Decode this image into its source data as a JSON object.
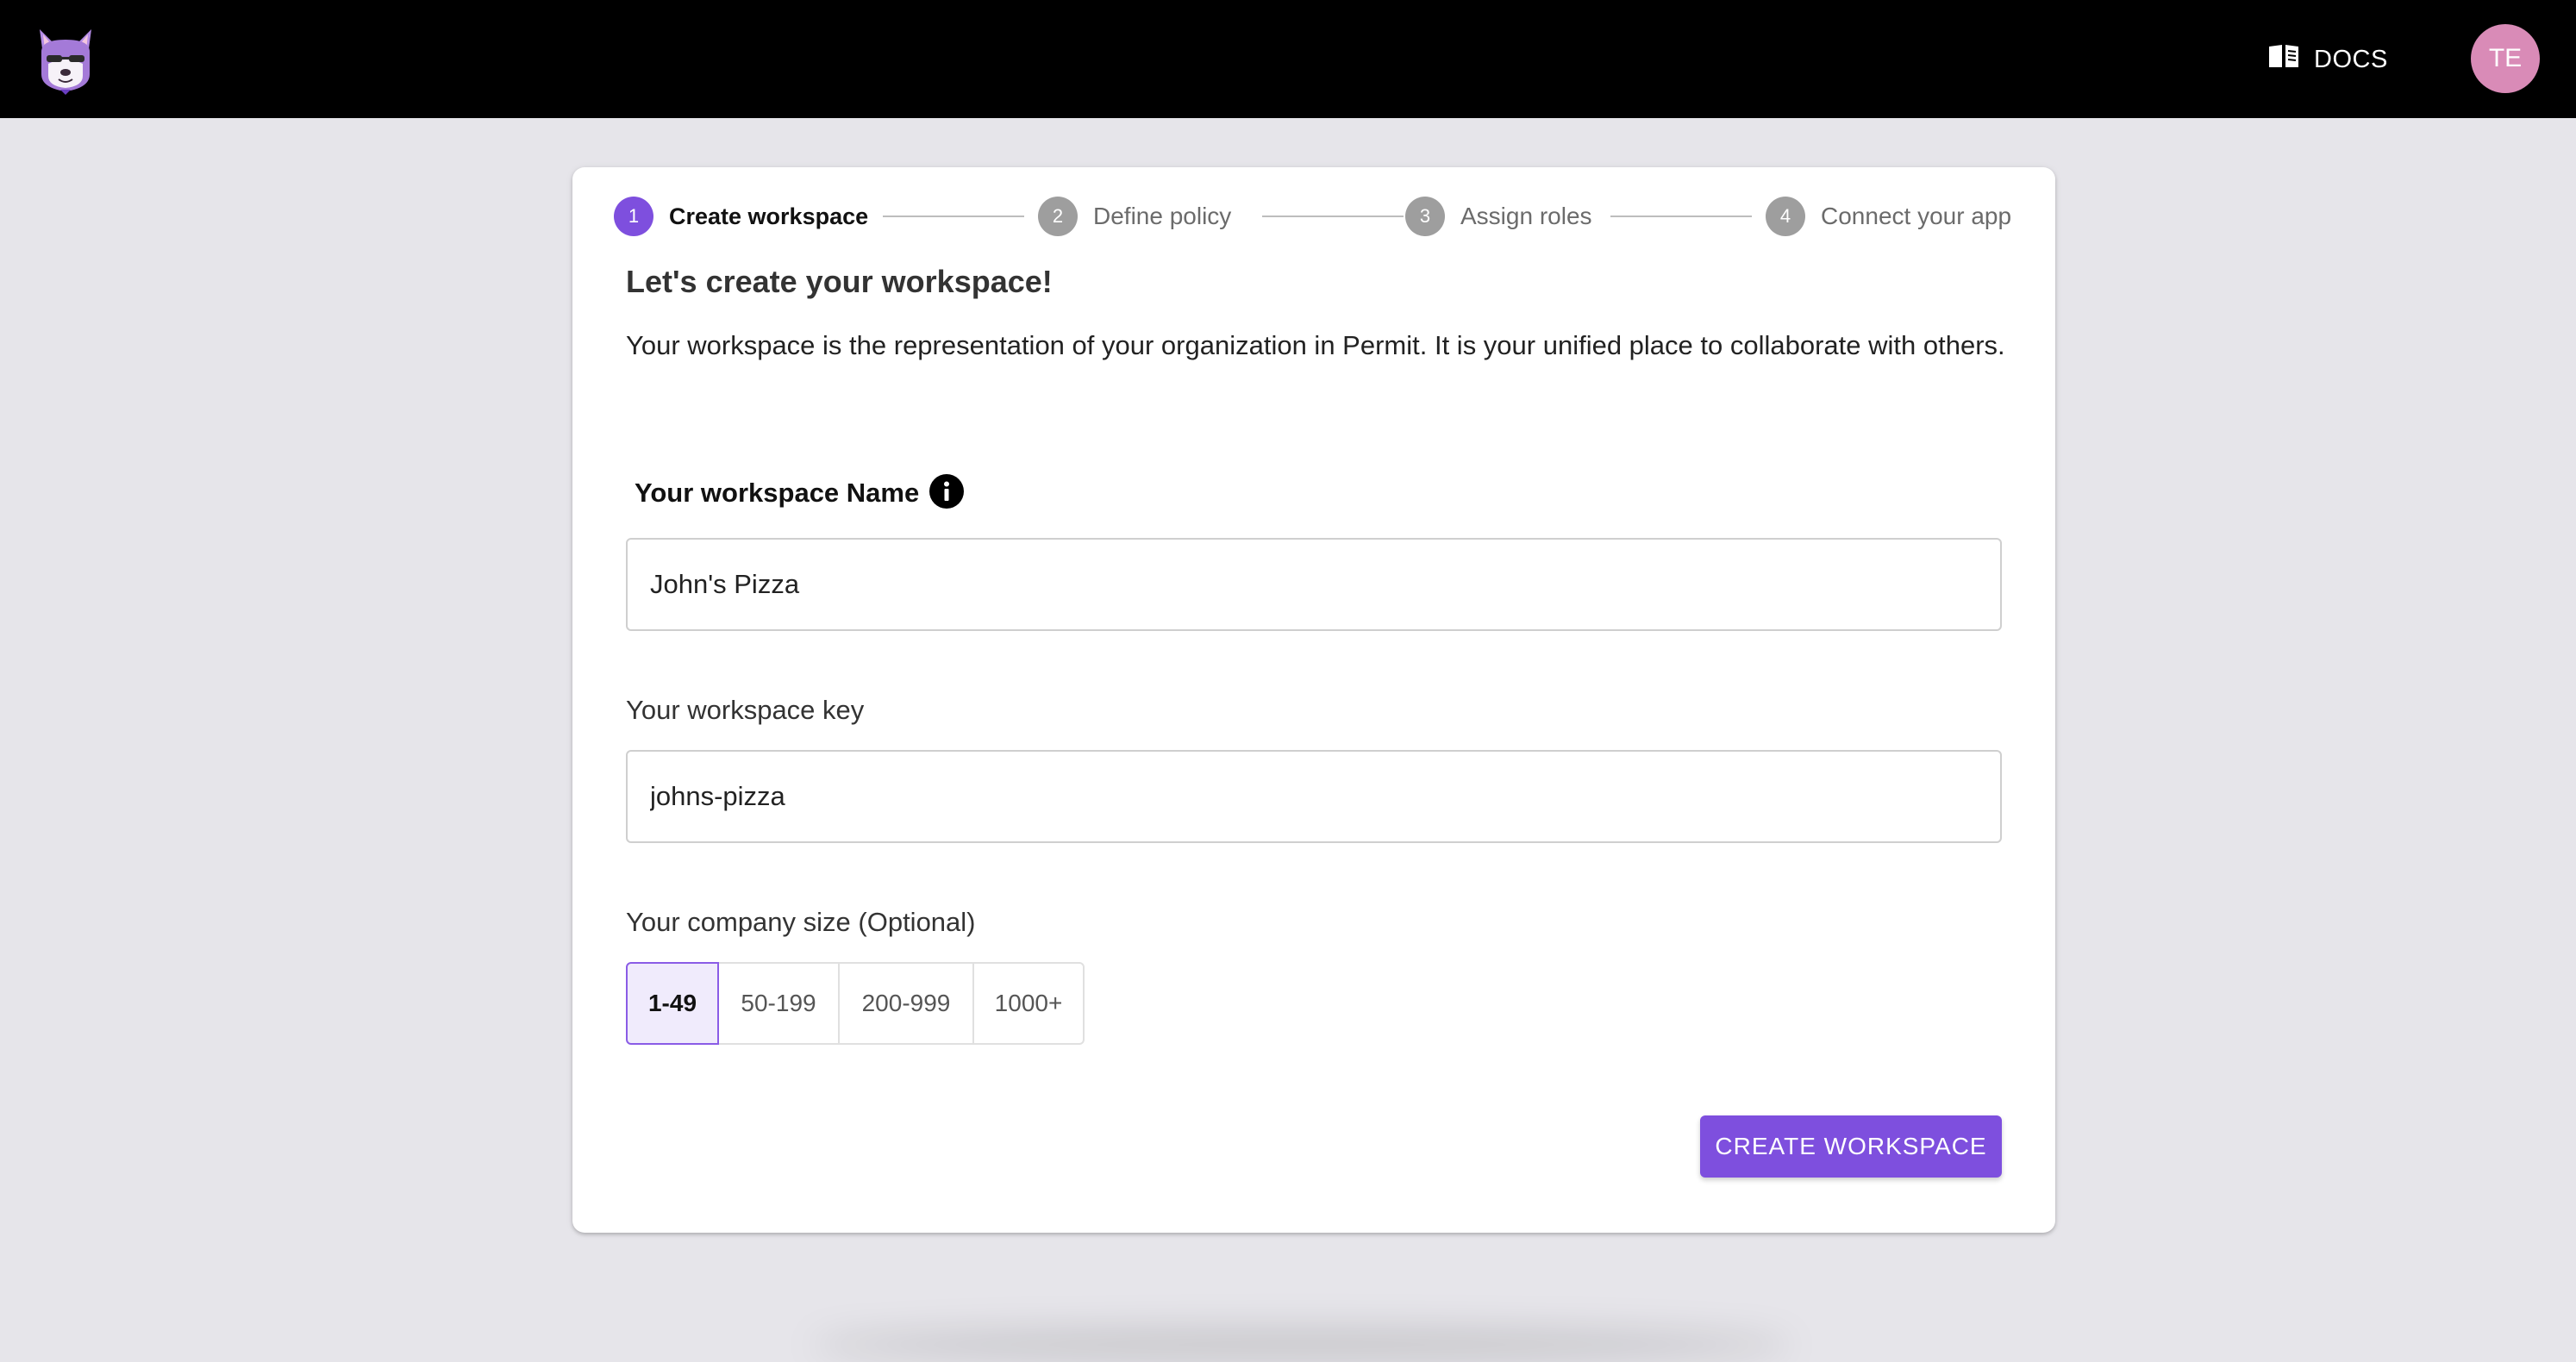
{
  "header": {
    "logo_icon": "fox-mascot-icon",
    "docs_icon": "open-book-icon",
    "docs_label": "DOCS",
    "avatar_initials": "TE",
    "avatar_color": "#d98bb7"
  },
  "stepper": {
    "steps": [
      {
        "number": "1",
        "label": "Create workspace",
        "active": true
      },
      {
        "number": "2",
        "label": "Define policy",
        "active": false
      },
      {
        "number": "3",
        "label": "Assign roles",
        "active": false
      },
      {
        "number": "4",
        "label": "Connect your app",
        "active": false
      }
    ]
  },
  "main": {
    "heading": "Let's create your workspace!",
    "description": "Your workspace is the representation of your organization in Permit. It is your unified place to collaborate with others.",
    "workspace_name": {
      "label": "Your workspace Name",
      "value": "John's Pizza"
    },
    "workspace_key": {
      "label": "Your workspace key",
      "value": "johns-pizza"
    },
    "company_size": {
      "label": "Your company size (Optional)",
      "options": [
        "1-49",
        "50-199",
        "200-999",
        "1000+"
      ],
      "selected": "1-49"
    },
    "submit_label": "CREATE WORKSPACE"
  },
  "colors": {
    "accent": "#7e4fde",
    "topbar": "#000000",
    "page_background": "#e6e5ea"
  }
}
